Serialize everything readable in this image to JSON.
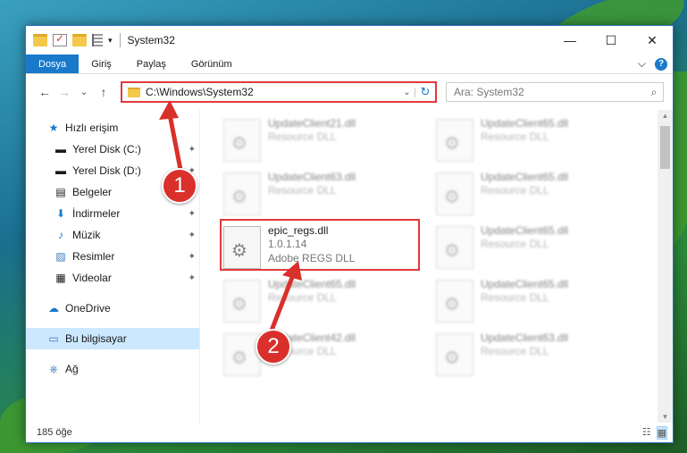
{
  "window": {
    "title": "System32",
    "controls": {
      "minimize": "—",
      "maximize": "☐",
      "close": "✕"
    }
  },
  "ribbon": {
    "tabs": [
      "Dosya",
      "Giriş",
      "Paylaş",
      "Görünüm"
    ],
    "expand_icon": "⌵",
    "help_label": "?"
  },
  "navigation": {
    "back": "←",
    "forward": "→",
    "recent": "⌄",
    "up": "↑",
    "address": "C:\\Windows\\System32",
    "address_dropdown": "⌄",
    "refresh": "↻",
    "search_placeholder": "Ara: System32",
    "search_icon": "⌕"
  },
  "sidebar": {
    "quick_access": {
      "label": "Hızlı erişim",
      "icon": "★"
    },
    "quick_items": [
      {
        "label": "Yerel Disk (C:)",
        "icon": "▬"
      },
      {
        "label": "Yerel Disk (D:)",
        "icon": "▬"
      },
      {
        "label": "Belgeler",
        "icon": "▤"
      },
      {
        "label": "İndirmeler",
        "icon": "⬇"
      },
      {
        "label": "Müzik",
        "icon": "♪"
      },
      {
        "label": "Resimler",
        "icon": "▨"
      },
      {
        "label": "Videolar",
        "icon": "▦"
      }
    ],
    "pin_icon": "📌",
    "onedrive": {
      "label": "OneDrive",
      "icon": "☁"
    },
    "this_pc": {
      "label": "Bu bilgisayar",
      "icon": "▭"
    },
    "network": {
      "label": "Ağ",
      "icon": "⎈"
    }
  },
  "files": {
    "left": [
      {
        "name": "UpdateClient21.dll",
        "desc": "Resource DLL"
      },
      {
        "name": "UpdateClient63.dll",
        "desc": "Resource DLL"
      },
      {
        "name": "epic_regs.dll",
        "version": "1.0.1.14",
        "desc": "Adobe REGS DLL"
      },
      {
        "name": "UpdateClient65.dll",
        "desc": "Resource DLL"
      },
      {
        "name": "UpdateClient42.dll",
        "desc": "Resource DLL"
      }
    ],
    "right": [
      {
        "name": "UpdateClient65.dll",
        "desc": "Resource DLL"
      },
      {
        "name": "UpdateClient65.dll",
        "desc": "Resource DLL"
      },
      {
        "name": "UpdateClient65.dll",
        "desc": "Resource DLL"
      },
      {
        "name": "UpdateClient65.dll",
        "desc": "Resource DLL"
      },
      {
        "name": "UpdateClient63.dll",
        "desc": "Resource DLL"
      }
    ]
  },
  "status": {
    "item_count": "185 öğe"
  },
  "annotations": {
    "badge1": "1",
    "badge2": "2",
    "color": "#d9302b"
  }
}
